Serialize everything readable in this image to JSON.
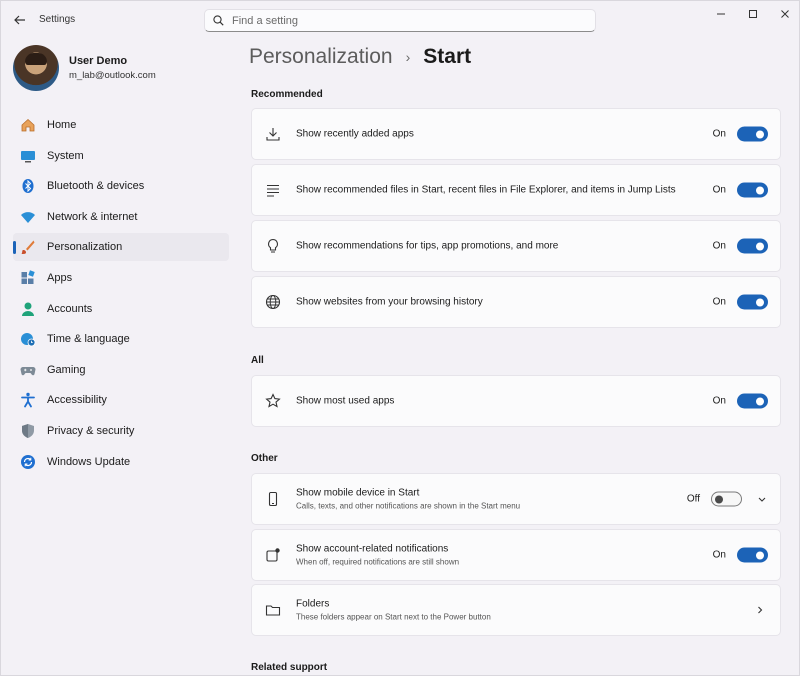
{
  "window": {
    "title": "Settings",
    "controls": [
      "minimize",
      "maximize",
      "close"
    ]
  },
  "search": {
    "placeholder": "Find a setting"
  },
  "profile": {
    "name": "User Demo",
    "email": "m_lab@outlook.com"
  },
  "sidebar": {
    "items": [
      {
        "label": "Home",
        "icon": "home-icon"
      },
      {
        "label": "System",
        "icon": "monitor-icon"
      },
      {
        "label": "Bluetooth & devices",
        "icon": "bluetooth-icon"
      },
      {
        "label": "Network & internet",
        "icon": "wifi-icon"
      },
      {
        "label": "Personalization",
        "icon": "brush-icon",
        "active": true
      },
      {
        "label": "Apps",
        "icon": "apps-icon"
      },
      {
        "label": "Accounts",
        "icon": "person-icon"
      },
      {
        "label": "Time & language",
        "icon": "globe-clock-icon"
      },
      {
        "label": "Gaming",
        "icon": "gamepad-icon"
      },
      {
        "label": "Accessibility",
        "icon": "accessibility-icon"
      },
      {
        "label": "Privacy & security",
        "icon": "shield-icon"
      },
      {
        "label": "Windows Update",
        "icon": "update-icon"
      }
    ]
  },
  "breadcrumb": {
    "parent": "Personalization",
    "separator": "›",
    "current": "Start"
  },
  "sections": {
    "recommended": "Recommended",
    "all": "All",
    "other": "Other",
    "related": "Related support"
  },
  "settings": {
    "recent_apps": {
      "title": "Show recently added apps",
      "state": "On",
      "icon": "download-icon"
    },
    "recommended_files": {
      "title": "Show recommended files in Start, recent files in File Explorer, and items in Jump Lists",
      "state": "On",
      "icon": "list-icon"
    },
    "tips": {
      "title": "Show recommendations for tips, app promotions, and more",
      "state": "On",
      "icon": "lightbulb-icon"
    },
    "websites": {
      "title": "Show websites from your browsing history",
      "state": "On",
      "icon": "globe-icon"
    },
    "most_used": {
      "title": "Show most used apps",
      "state": "On",
      "icon": "star-icon"
    },
    "mobile_device": {
      "title": "Show mobile device in Start",
      "subtitle": "Calls, texts, and other notifications are shown in the Start menu",
      "state": "Off",
      "icon": "phone-icon"
    },
    "account_notifications": {
      "title": "Show account-related notifications",
      "subtitle": "When off, required notifications are still shown",
      "state": "On",
      "icon": "notification-icon"
    },
    "folders": {
      "title": "Folders",
      "subtitle": "These folders appear on Start next to the Power button",
      "icon": "folder-icon"
    }
  },
  "colors": {
    "accent": "#1c63b7",
    "background": "#f3f1f6",
    "card": "#fbfbfc"
  }
}
